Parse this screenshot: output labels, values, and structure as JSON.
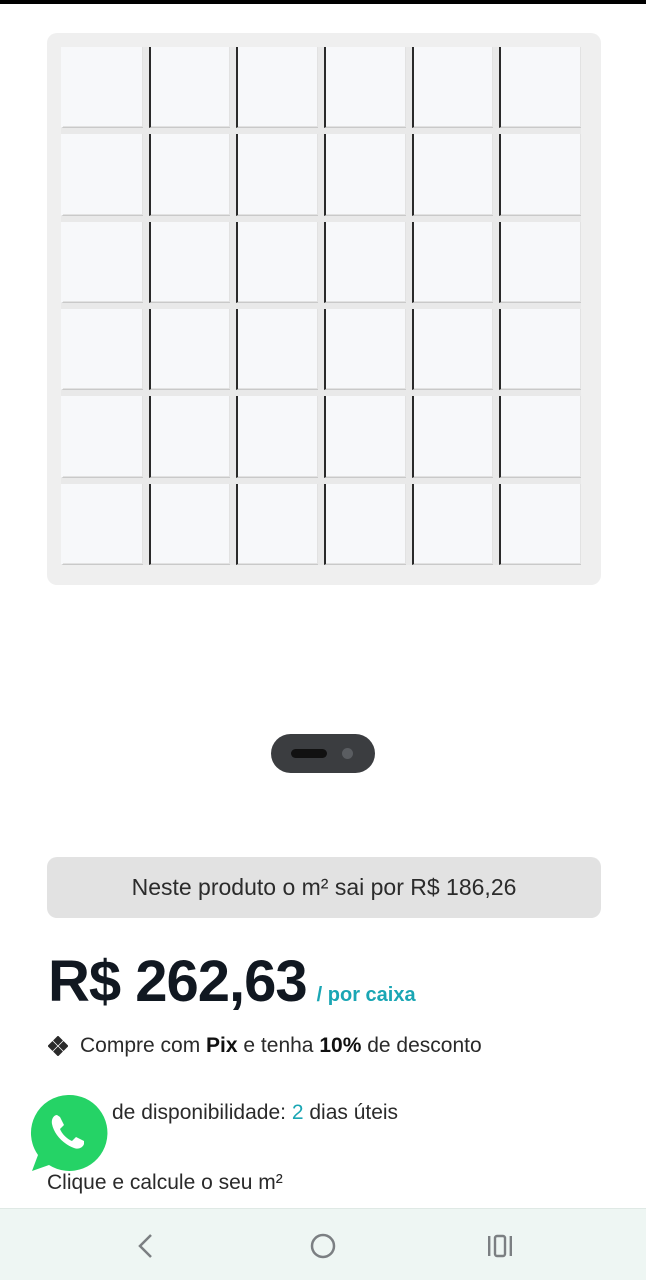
{
  "product": {
    "m2_banner": "Neste produto o m² sai por R$ 186,26",
    "price": "R$ 262,63",
    "price_unit": "/ por caixa",
    "pix": {
      "prefix": "Compre com",
      "method": "Pix",
      "middle": "e tenha",
      "discount": "10%",
      "suffix": "de desconto"
    },
    "availability": {
      "label": "de disponibilidade:",
      "days": "2",
      "unit": "dias úteis"
    },
    "calculator_link": "Clique e calcule o seu m²"
  },
  "carousel": {
    "total": 2,
    "active": 1
  },
  "colors": {
    "accent": "#1aa6b4",
    "price": "#111821",
    "whatsapp": "#25d366",
    "banner_bg": "#e2e2e2"
  },
  "icons": {
    "whatsapp": "whatsapp-icon",
    "pix": "pix-icon",
    "back": "back-icon",
    "home": "home-icon",
    "recent": "recent-apps-icon"
  }
}
